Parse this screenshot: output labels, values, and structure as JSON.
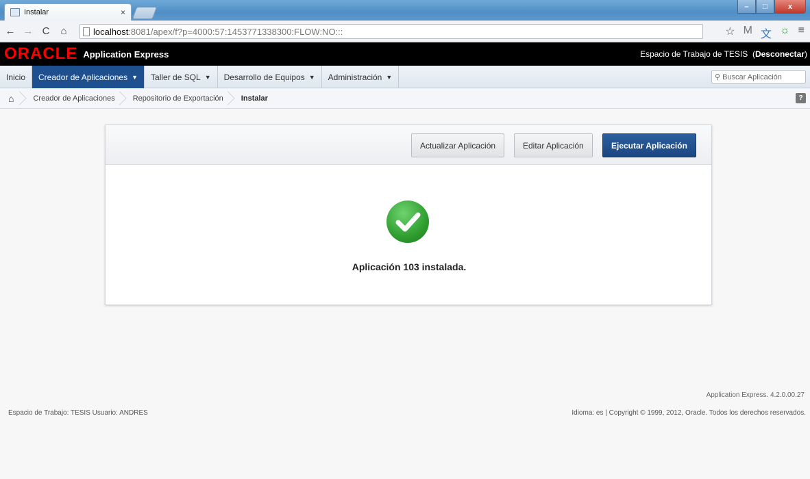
{
  "browser": {
    "tab_title": "Instalar",
    "tab_close": "×",
    "url_host": "localhost",
    "url_path": ":8081/apex/f?p=4000:57:1453771338300:FLOW:NO:::"
  },
  "header": {
    "logo": "ORACLE",
    "product": "Application Express",
    "workspace_text": "Espacio de Trabajo de TESIS",
    "logout": "Desconectar"
  },
  "menu": {
    "items": [
      {
        "label": "Inicio"
      },
      {
        "label": "Creador de Aplicaciones",
        "active": true
      },
      {
        "label": "Taller de SQL"
      },
      {
        "label": "Desarrollo de Equipos"
      },
      {
        "label": "Administración"
      }
    ],
    "search_placeholder": "Buscar Aplicación"
  },
  "breadcrumbs": {
    "items": [
      "Creador de Aplicaciones",
      "Repositorio de Exportación",
      "Instalar"
    ]
  },
  "panel": {
    "update_label": "Actualizar Aplicación",
    "edit_label": "Editar Aplicación",
    "run_label": "Ejecutar Aplicación",
    "message": "Aplicación 103 instalada."
  },
  "footer": {
    "version": "Application Express. 4.2.0.00.27",
    "left": "Espacio de Trabajo: TESIS Usuario: ANDRES",
    "right": "Idioma: es | Copyright © 1999, 2012, Oracle. Todos los derechos reservados."
  },
  "colors": {
    "accent": "#1e4f8f",
    "oracle_red": "#f80000",
    "success": "#2f9e2f"
  }
}
